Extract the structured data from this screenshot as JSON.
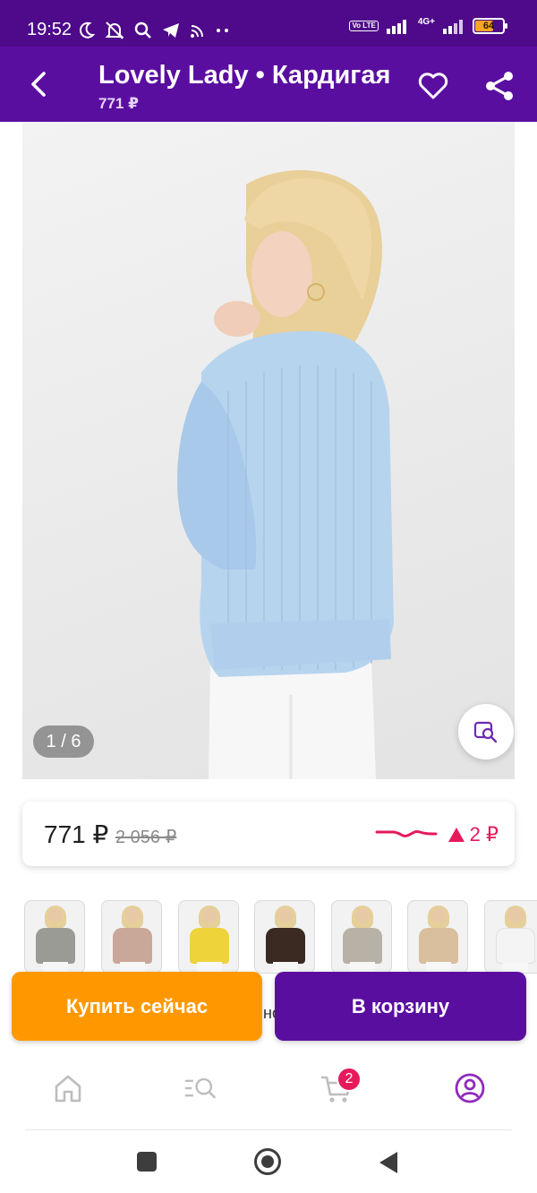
{
  "status_bar": {
    "time": "19:52",
    "battery_level": "64",
    "network": "4G+",
    "volte": "Vo LTE"
  },
  "app_bar": {
    "title": "Lovely Lady • Кардигая",
    "subtitle": "771 ₽",
    "back_icon": "back-arrow-icon",
    "favorite_icon": "heart-icon",
    "share_icon": "share-icon"
  },
  "gallery": {
    "counter": "1 / 6",
    "visual_search_icon": "image-search-icon"
  },
  "price": {
    "current": "771 ₽",
    "old": "2 056 ₽",
    "change": "2 ₽",
    "change_direction": "up",
    "accent_color": "#e6195b"
  },
  "variants": [
    {
      "color": "#9b9b96"
    },
    {
      "color": "#c9a89a"
    },
    {
      "color": "#efd33a"
    },
    {
      "color": "#3a2a22"
    },
    {
      "color": "#b8b2a6"
    },
    {
      "color": "#d9bf9e"
    },
    {
      "color": "#f4f4f4"
    }
  ],
  "peek_text": "но",
  "actions": {
    "buy_now": "Купить сейчас",
    "add_to_cart": "В корзину"
  },
  "bottom_nav": {
    "items": [
      {
        "icon": "home-icon"
      },
      {
        "icon": "catalog-search-icon"
      },
      {
        "icon": "cart-icon"
      },
      {
        "icon": "profile-icon"
      }
    ],
    "cart_badge": "2",
    "active_color": "#8e2bbd"
  },
  "colors": {
    "brand_purple": "#5a0ea0",
    "buy_orange": "#ff9800"
  }
}
